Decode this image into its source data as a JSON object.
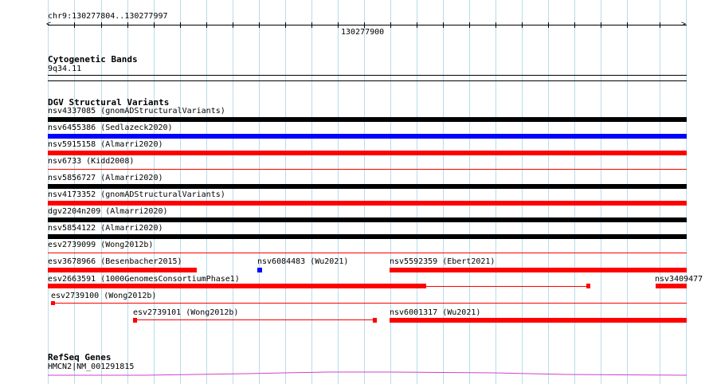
{
  "ruler": {
    "region": "chr9:130277804..130277997",
    "tick_label": "130277900",
    "left_arrow": "<",
    "right_arrow": ">"
  },
  "cytoband": {
    "title": "Cytogenetic Bands",
    "band": "9q34.11"
  },
  "dgv": {
    "title": "DGV Structural Variants",
    "colors": {
      "black": "#000000",
      "blue": "#0000ff",
      "red": "#ff0000"
    },
    "rows": [
      {
        "label": "nsv4337085 (gnomADStructuralVariants)",
        "color": "black"
      },
      {
        "label": "nsv6455386 (Sedlazeck2020)",
        "color": "blue"
      },
      {
        "label": "nsv5915158 (Almarri2020)",
        "color": "red"
      },
      {
        "label": "nsv6733 (Kidd2008)",
        "color": "red"
      },
      {
        "label": "nsv5856727 (Almarri2020)",
        "color": "black"
      },
      {
        "label": "nsv4173352 (gnomADStructuralVariants)",
        "color": "red"
      },
      {
        "label": "dgv2204n209 (Almarri2020)",
        "color": "black"
      },
      {
        "label": "nsv5854122 (Almarri2020)",
        "color": "black"
      },
      {
        "label": "esv2739099 (Wong2012b)",
        "color": "red"
      }
    ],
    "row10": [
      {
        "label": "esv3678966 (Besenbacher2015)",
        "color": "red"
      },
      {
        "label": "nsv6084483 (Wu2021)",
        "color": "blue"
      },
      {
        "label": "nsv5592359 (Ebert2021)",
        "color": "red"
      }
    ],
    "row11": [
      {
        "label": "esv2663591 (1000GenomesConsortiumPhase1)",
        "color": "red"
      },
      {
        "label": "nsv3409477",
        "color": "red"
      }
    ],
    "row12": [
      {
        "label": "esv2739100 (Wong2012b)",
        "color": "red"
      }
    ],
    "row13": [
      {
        "label": "esv2739101 (Wong2012b)",
        "color": "red"
      },
      {
        "label": "nsv6001317 (Wu2021)",
        "color": "red"
      }
    ]
  },
  "refseq": {
    "title": "RefSeq Genes",
    "gene": "HMCN2|NM_001291815",
    "color": "#cc44cc"
  }
}
